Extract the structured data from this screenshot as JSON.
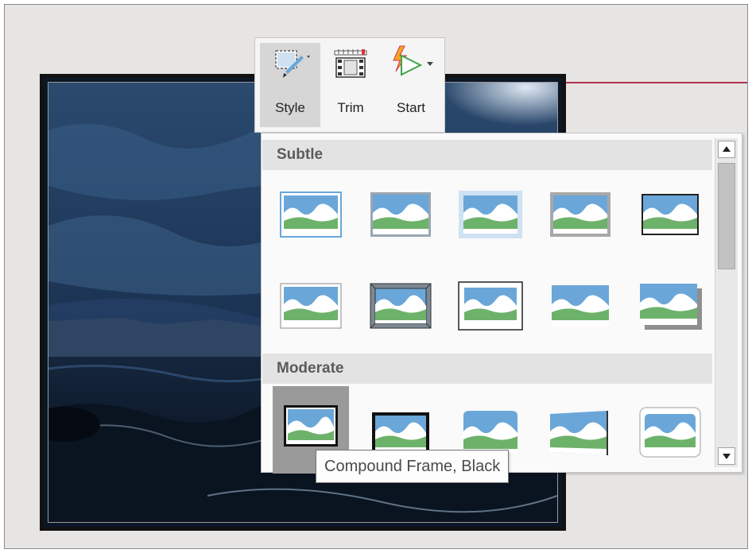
{
  "toolbar": {
    "buttons": [
      {
        "label": "Style",
        "icon": "video-style-icon"
      },
      {
        "label": "Trim",
        "icon": "trim-video-icon"
      },
      {
        "label": "Start",
        "icon": "start-playback-icon"
      }
    ]
  },
  "gallery": {
    "sections": [
      {
        "title": "Subtle",
        "styles": 10
      },
      {
        "title": "Moderate",
        "styles": 5
      }
    ],
    "selected_section": "Moderate",
    "selected_index": 0
  },
  "tooltip": {
    "text": "Compound Frame, Black"
  },
  "colors": {
    "accent_line": "#b0344d",
    "thumb_sky": "#6aa7d8",
    "thumb_hill": "#6db26a",
    "selected_cell": "#9a9a9a"
  }
}
